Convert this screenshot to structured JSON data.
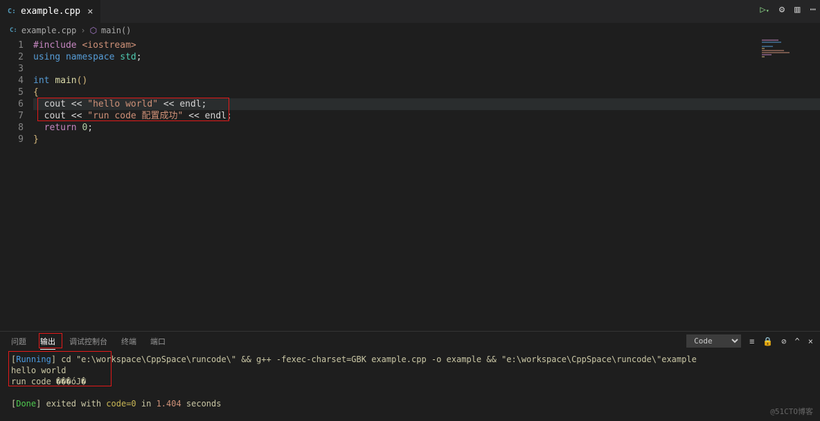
{
  "tab": {
    "filename": "example.cpp",
    "icon_label": "C:"
  },
  "breadcrumb": {
    "file": "example.cpp",
    "symbol": "main()",
    "symbol_icon": "⬡"
  },
  "code": {
    "lines": [
      {
        "n": "1",
        "tokens": [
          {
            "t": "#include",
            "c": "c-pink"
          },
          {
            "t": " ",
            "c": "c-white"
          },
          {
            "t": "<iostream>",
            "c": "c-orange"
          }
        ]
      },
      {
        "n": "2",
        "tokens": [
          {
            "t": "using",
            "c": "c-blue"
          },
          {
            "t": " ",
            "c": "c-white"
          },
          {
            "t": "namespace",
            "c": "c-blue"
          },
          {
            "t": " ",
            "c": "c-white"
          },
          {
            "t": "std",
            "c": "c-green"
          },
          {
            "t": ";",
            "c": "c-white"
          }
        ]
      },
      {
        "n": "3",
        "tokens": []
      },
      {
        "n": "4",
        "tokens": [
          {
            "t": "int",
            "c": "c-blue"
          },
          {
            "t": " ",
            "c": "c-white"
          },
          {
            "t": "main",
            "c": "c-yellow"
          },
          {
            "t": "()",
            "c": "c-gold"
          }
        ]
      },
      {
        "n": "5",
        "tokens": [
          {
            "t": "{",
            "c": "c-gold"
          }
        ]
      },
      {
        "n": "6",
        "hl": true,
        "tokens": [
          {
            "t": "  cout ",
            "c": "c-white"
          },
          {
            "t": "<<",
            "c": "c-white"
          },
          {
            "t": " ",
            "c": "c-white"
          },
          {
            "t": "\"hello world\"",
            "c": "c-orange"
          },
          {
            "t": " ",
            "c": "c-white"
          },
          {
            "t": "<<",
            "c": "c-white"
          },
          {
            "t": " endl;",
            "c": "c-white"
          }
        ]
      },
      {
        "n": "7",
        "tokens": [
          {
            "t": "  cout ",
            "c": "c-white"
          },
          {
            "t": "<<",
            "c": "c-white"
          },
          {
            "t": " ",
            "c": "c-white"
          },
          {
            "t": "\"run code 配置成功\"",
            "c": "c-orange"
          },
          {
            "t": " ",
            "c": "c-white"
          },
          {
            "t": "<<",
            "c": "c-white"
          },
          {
            "t": " endl;",
            "c": "c-white"
          }
        ]
      },
      {
        "n": "8",
        "tokens": [
          {
            "t": "  ",
            "c": "c-white"
          },
          {
            "t": "return",
            "c": "c-pink"
          },
          {
            "t": " ",
            "c": "c-white"
          },
          {
            "t": "0",
            "c": "c-lgreen"
          },
          {
            "t": ";",
            "c": "c-white"
          }
        ]
      },
      {
        "n": "9",
        "tokens": [
          {
            "t": "}",
            "c": "c-gold"
          }
        ]
      }
    ]
  },
  "panel": {
    "tabs": {
      "problems": "问题",
      "output": "输出",
      "debug_console": "调试控制台",
      "terminal": "终端",
      "ports": "端口"
    },
    "active_tab": "output",
    "dropdown": "Code",
    "output_lines": [
      [
        {
          "t": "[",
          "c": "o-cream"
        },
        {
          "t": "Running",
          "c": "o-blue"
        },
        {
          "t": "] ",
          "c": "o-cream"
        },
        {
          "t": "cd \"e:\\workspace\\CppSpace\\runcode\\\" && g++ -fexec-charset=GBK example.cpp -o example && \"e:\\workspace\\CppSpace\\runcode\\\"example",
          "c": "o-cream"
        }
      ],
      [
        {
          "t": "hello world",
          "c": "o-cream"
        }
      ],
      [
        {
          "t": "run code ���óJ�",
          "c": "o-cream"
        }
      ],
      [
        {
          "t": "",
          "c": ""
        }
      ],
      [
        {
          "t": "[",
          "c": "o-cream"
        },
        {
          "t": "Done",
          "c": "o-green"
        },
        {
          "t": "] exited with ",
          "c": "o-cream"
        },
        {
          "t": "code=0",
          "c": "o-gold"
        },
        {
          "t": " in ",
          "c": "o-cream"
        },
        {
          "t": "1.404",
          "c": "o-orange"
        },
        {
          "t": " seconds",
          "c": "o-cream"
        }
      ]
    ]
  },
  "watermark": "@51CTO博客"
}
